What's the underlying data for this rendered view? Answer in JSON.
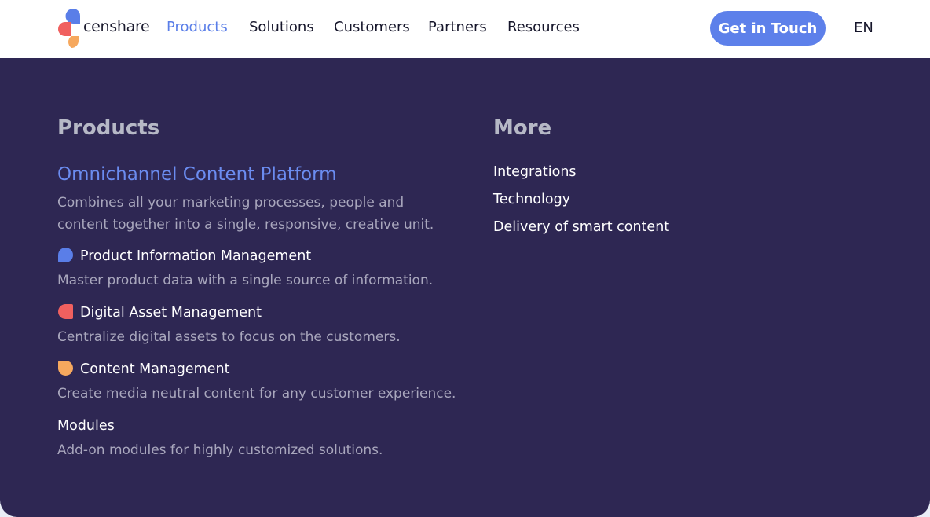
{
  "header": {
    "logo_text": "censhare",
    "nav": [
      {
        "label": "Products",
        "active": true
      },
      {
        "label": "Solutions",
        "active": false
      },
      {
        "label": "Customers",
        "active": false
      },
      {
        "label": "Partners",
        "active": false
      },
      {
        "label": "Resources",
        "active": false
      }
    ],
    "cta_label": "Get in Touch",
    "language": "EN"
  },
  "menu": {
    "products": {
      "heading": "Products",
      "featured": {
        "title": "Omnichannel Content Platform",
        "desc_line1": "Combines all your marketing processes, people and",
        "desc_line2": "content together into a single, responsive, creative unit."
      },
      "items": [
        {
          "icon": "pim-blob-icon",
          "title": "Product Information Management",
          "desc": "Master product data with a single source of information."
        },
        {
          "icon": "dam-blob-icon",
          "title": "Digital Asset Management",
          "desc": "Centralize digital assets to focus on the customers."
        },
        {
          "icon": "cm-blob-icon",
          "title": "Content Management",
          "desc": "Create media neutral content for any customer experience."
        },
        {
          "icon": "",
          "title": "Modules",
          "desc": "Add-on modules for highly customized solutions."
        }
      ]
    },
    "more": {
      "heading": "More",
      "links": [
        "Integrations",
        "Technology",
        "Delivery of smart content"
      ]
    }
  },
  "colors": {
    "accent": "#5d80ea",
    "panel": "#2e2753",
    "pim": "#5a7ee8",
    "dam": "#f0605f",
    "cm": "#f6a85e"
  }
}
